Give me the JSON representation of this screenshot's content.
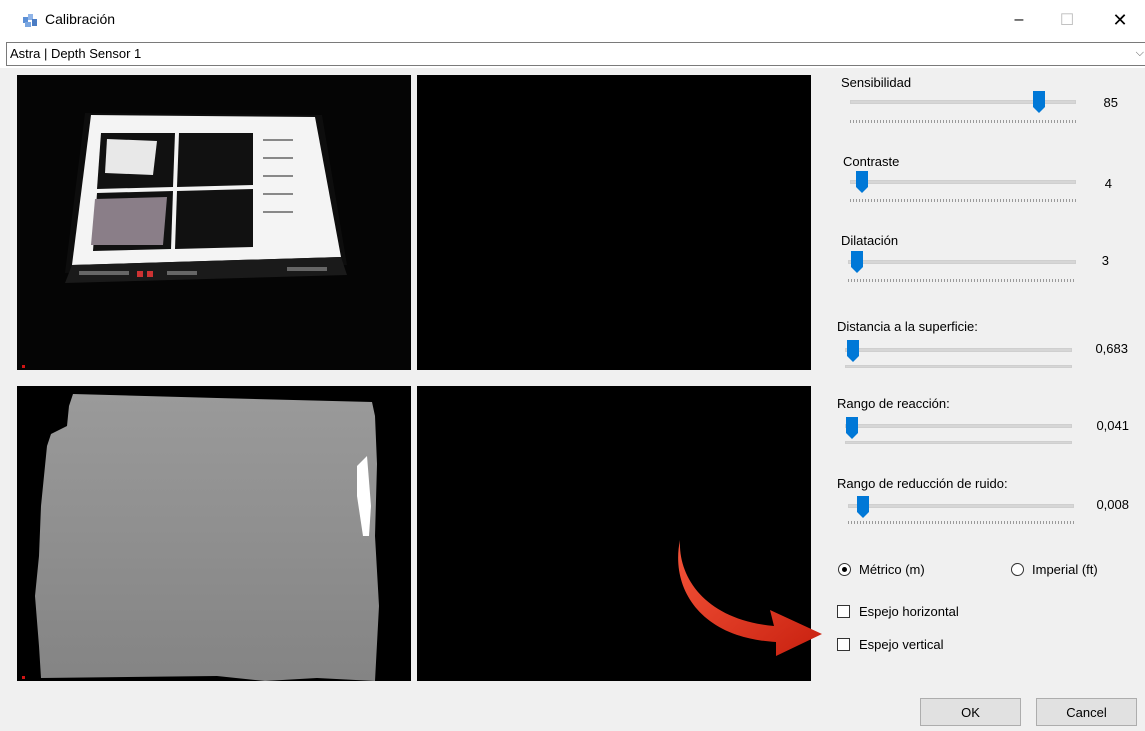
{
  "window": {
    "title": "Calibración",
    "icon": "calibration-app-icon",
    "controls": {
      "minimize": "–",
      "maximize": "☐",
      "close": "✕"
    }
  },
  "device_selector": {
    "value": "Astra | Depth Sensor 1",
    "arrow": "⌵"
  },
  "sliders": [
    {
      "label": "Sensibilidad",
      "value": "85",
      "level": 0.85,
      "style": "ticks"
    },
    {
      "label": "Contraste",
      "value": "4",
      "level": 0.04,
      "style": "ticks"
    },
    {
      "label": "Dilatación",
      "value": "3",
      "level": 0.03,
      "style": "ticks"
    },
    {
      "label": "Distancia a la superficie:",
      "value": "0,683",
      "level": 0.02,
      "style": "solid"
    },
    {
      "label": "Rango de reacción:",
      "value": "0,041",
      "level": 0.02,
      "style": "solid"
    },
    {
      "label": "Rango de reducción de ruido:",
      "value": "0,008",
      "level": 0.04,
      "style": "ticks"
    }
  ],
  "units": {
    "metric": {
      "label": "Métrico (m)",
      "selected": true
    },
    "imperial": {
      "label": "Imperial (ft)",
      "selected": false
    }
  },
  "checkboxes": {
    "mirror_h": {
      "label": "Espejo horizontal",
      "checked": false
    },
    "mirror_v": {
      "label": "Espejo vertical",
      "checked": false
    }
  },
  "buttons": {
    "ok": "OK",
    "cancel": "Cancel"
  },
  "colors": {
    "thumb": "#0078d7",
    "annotation_arrow": "#e8321e"
  }
}
